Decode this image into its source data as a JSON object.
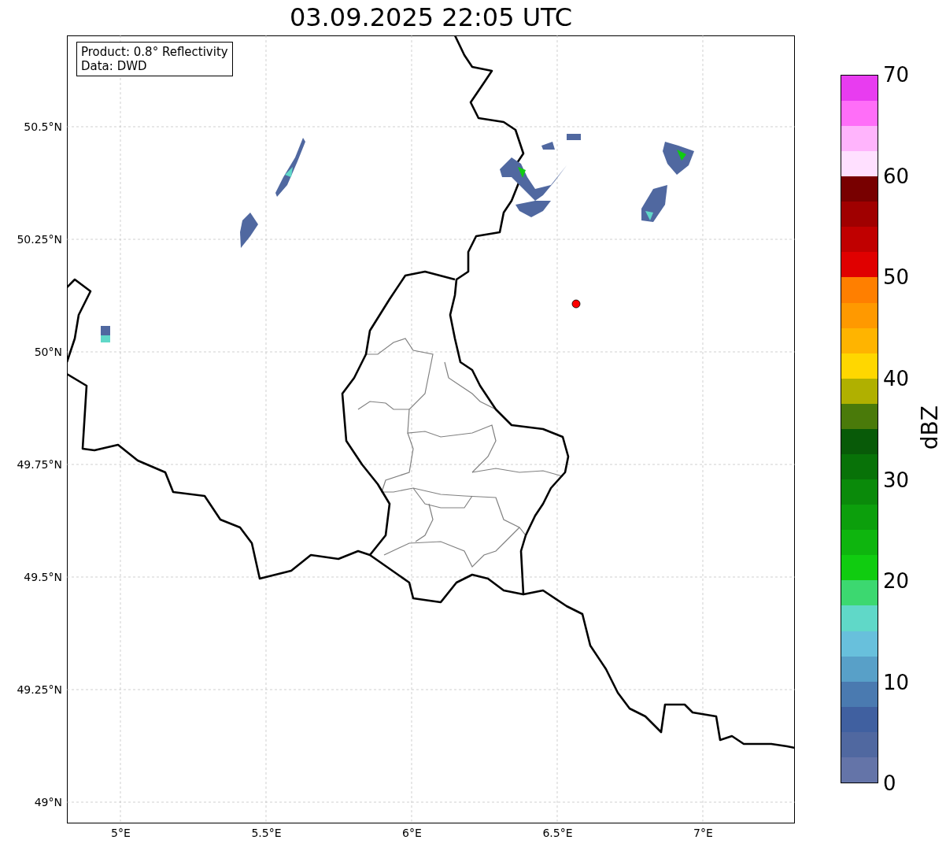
{
  "title": "03.09.2025 22:05 UTC",
  "info_box": {
    "lines": [
      "Product: 0.8° Reflectivity",
      "Data: DWD"
    ]
  },
  "y_ticks": [
    "50.5°N",
    "50.25°N",
    "50°N",
    "49.75°N",
    "49.5°N",
    "49.25°N",
    "49°N"
  ],
  "x_ticks": [
    "5°E",
    "5.5°E",
    "6°E",
    "6.5°E",
    "7°E"
  ],
  "colorbar": {
    "label": "dBZ",
    "ticks": [
      "70",
      "60",
      "50",
      "40",
      "30",
      "20",
      "10",
      "0"
    ],
    "bins": [
      {
        "color": "#6474a8"
      },
      {
        "color": "#5068a0"
      },
      {
        "color": "#4060a0"
      },
      {
        "color": "#4a7ab0"
      },
      {
        "color": "#58a0c8"
      },
      {
        "color": "#68c0dc"
      },
      {
        "color": "#60d8c8"
      },
      {
        "color": "#3cd870"
      },
      {
        "color": "#10cc10"
      },
      {
        "color": "#0eb50e"
      },
      {
        "color": "#0c9f0c"
      },
      {
        "color": "#0a8a0a"
      },
      {
        "color": "#087208"
      },
      {
        "color": "#085a08"
      },
      {
        "color": "#4a7a0a"
      },
      {
        "color": "#b0b000"
      },
      {
        "color": "#ffd700"
      },
      {
        "color": "#ffb400"
      },
      {
        "color": "#ff9900"
      },
      {
        "color": "#ff7f00"
      },
      {
        "color": "#e00000"
      },
      {
        "color": "#c00000"
      },
      {
        "color": "#a00000"
      },
      {
        "color": "#780000"
      },
      {
        "color": "#ffe0ff"
      },
      {
        "color": "#ffb4fc"
      },
      {
        "color": "#ff6ef8"
      },
      {
        "color": "#e83cf0"
      }
    ]
  }
}
